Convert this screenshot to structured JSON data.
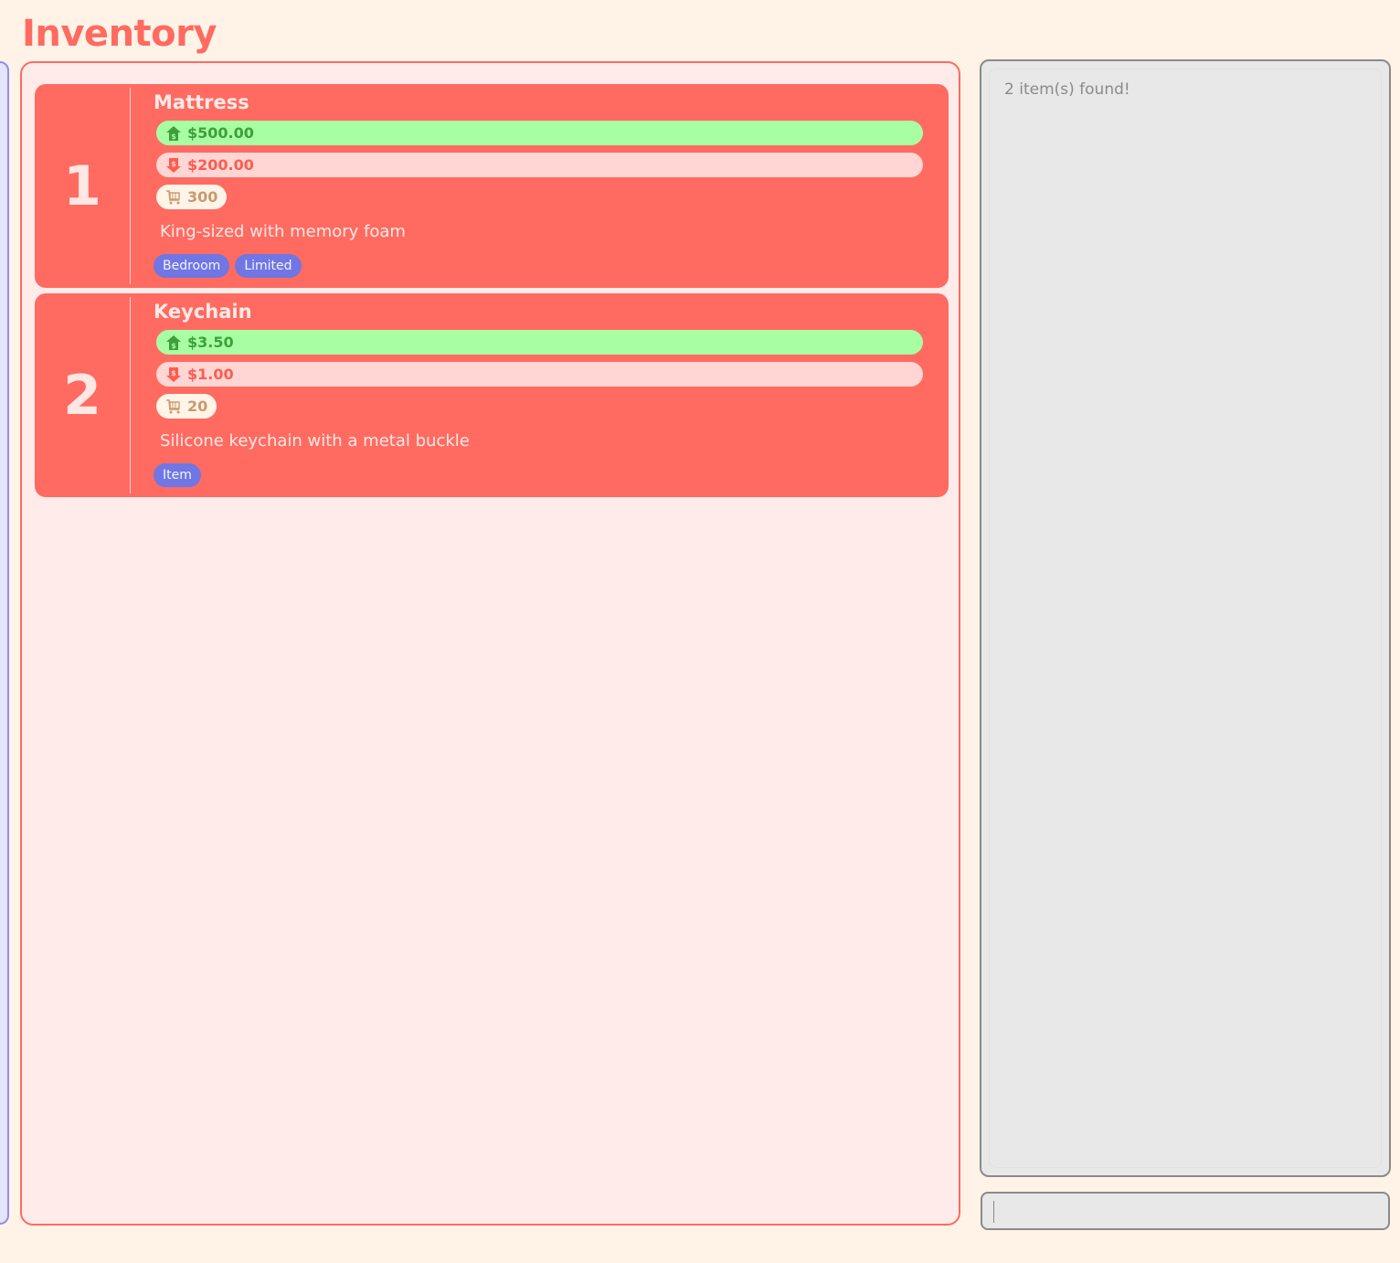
{
  "header": {
    "title": "Inventory"
  },
  "items": [
    {
      "index": "1",
      "name": "Mattress",
      "sell_price": "$500.00",
      "cost_price": "$200.00",
      "quantity": "300",
      "description": "King-sized with memory foam",
      "tags": [
        "Bedroom",
        "Limited"
      ]
    },
    {
      "index": "2",
      "name": "Keychain",
      "sell_price": "$3.50",
      "cost_price": "$1.00",
      "quantity": "20",
      "description": "Silicone keychain with a metal buckle",
      "tags": [
        "Item"
      ]
    }
  ],
  "result": {
    "message": "2 item(s) found!"
  },
  "command": {
    "value": "",
    "placeholder": ""
  },
  "icons": {
    "sell": "price-up-tag-icon",
    "cost": "price-down-tag-icon",
    "quantity": "shopping-cart-icon"
  },
  "colors": {
    "accent": "#ff6b61",
    "sell_bg": "#a8ffa3",
    "cost_bg": "#ffd6d3",
    "tag_bg": "#7076e3",
    "page_bg": "#fff3e7"
  }
}
